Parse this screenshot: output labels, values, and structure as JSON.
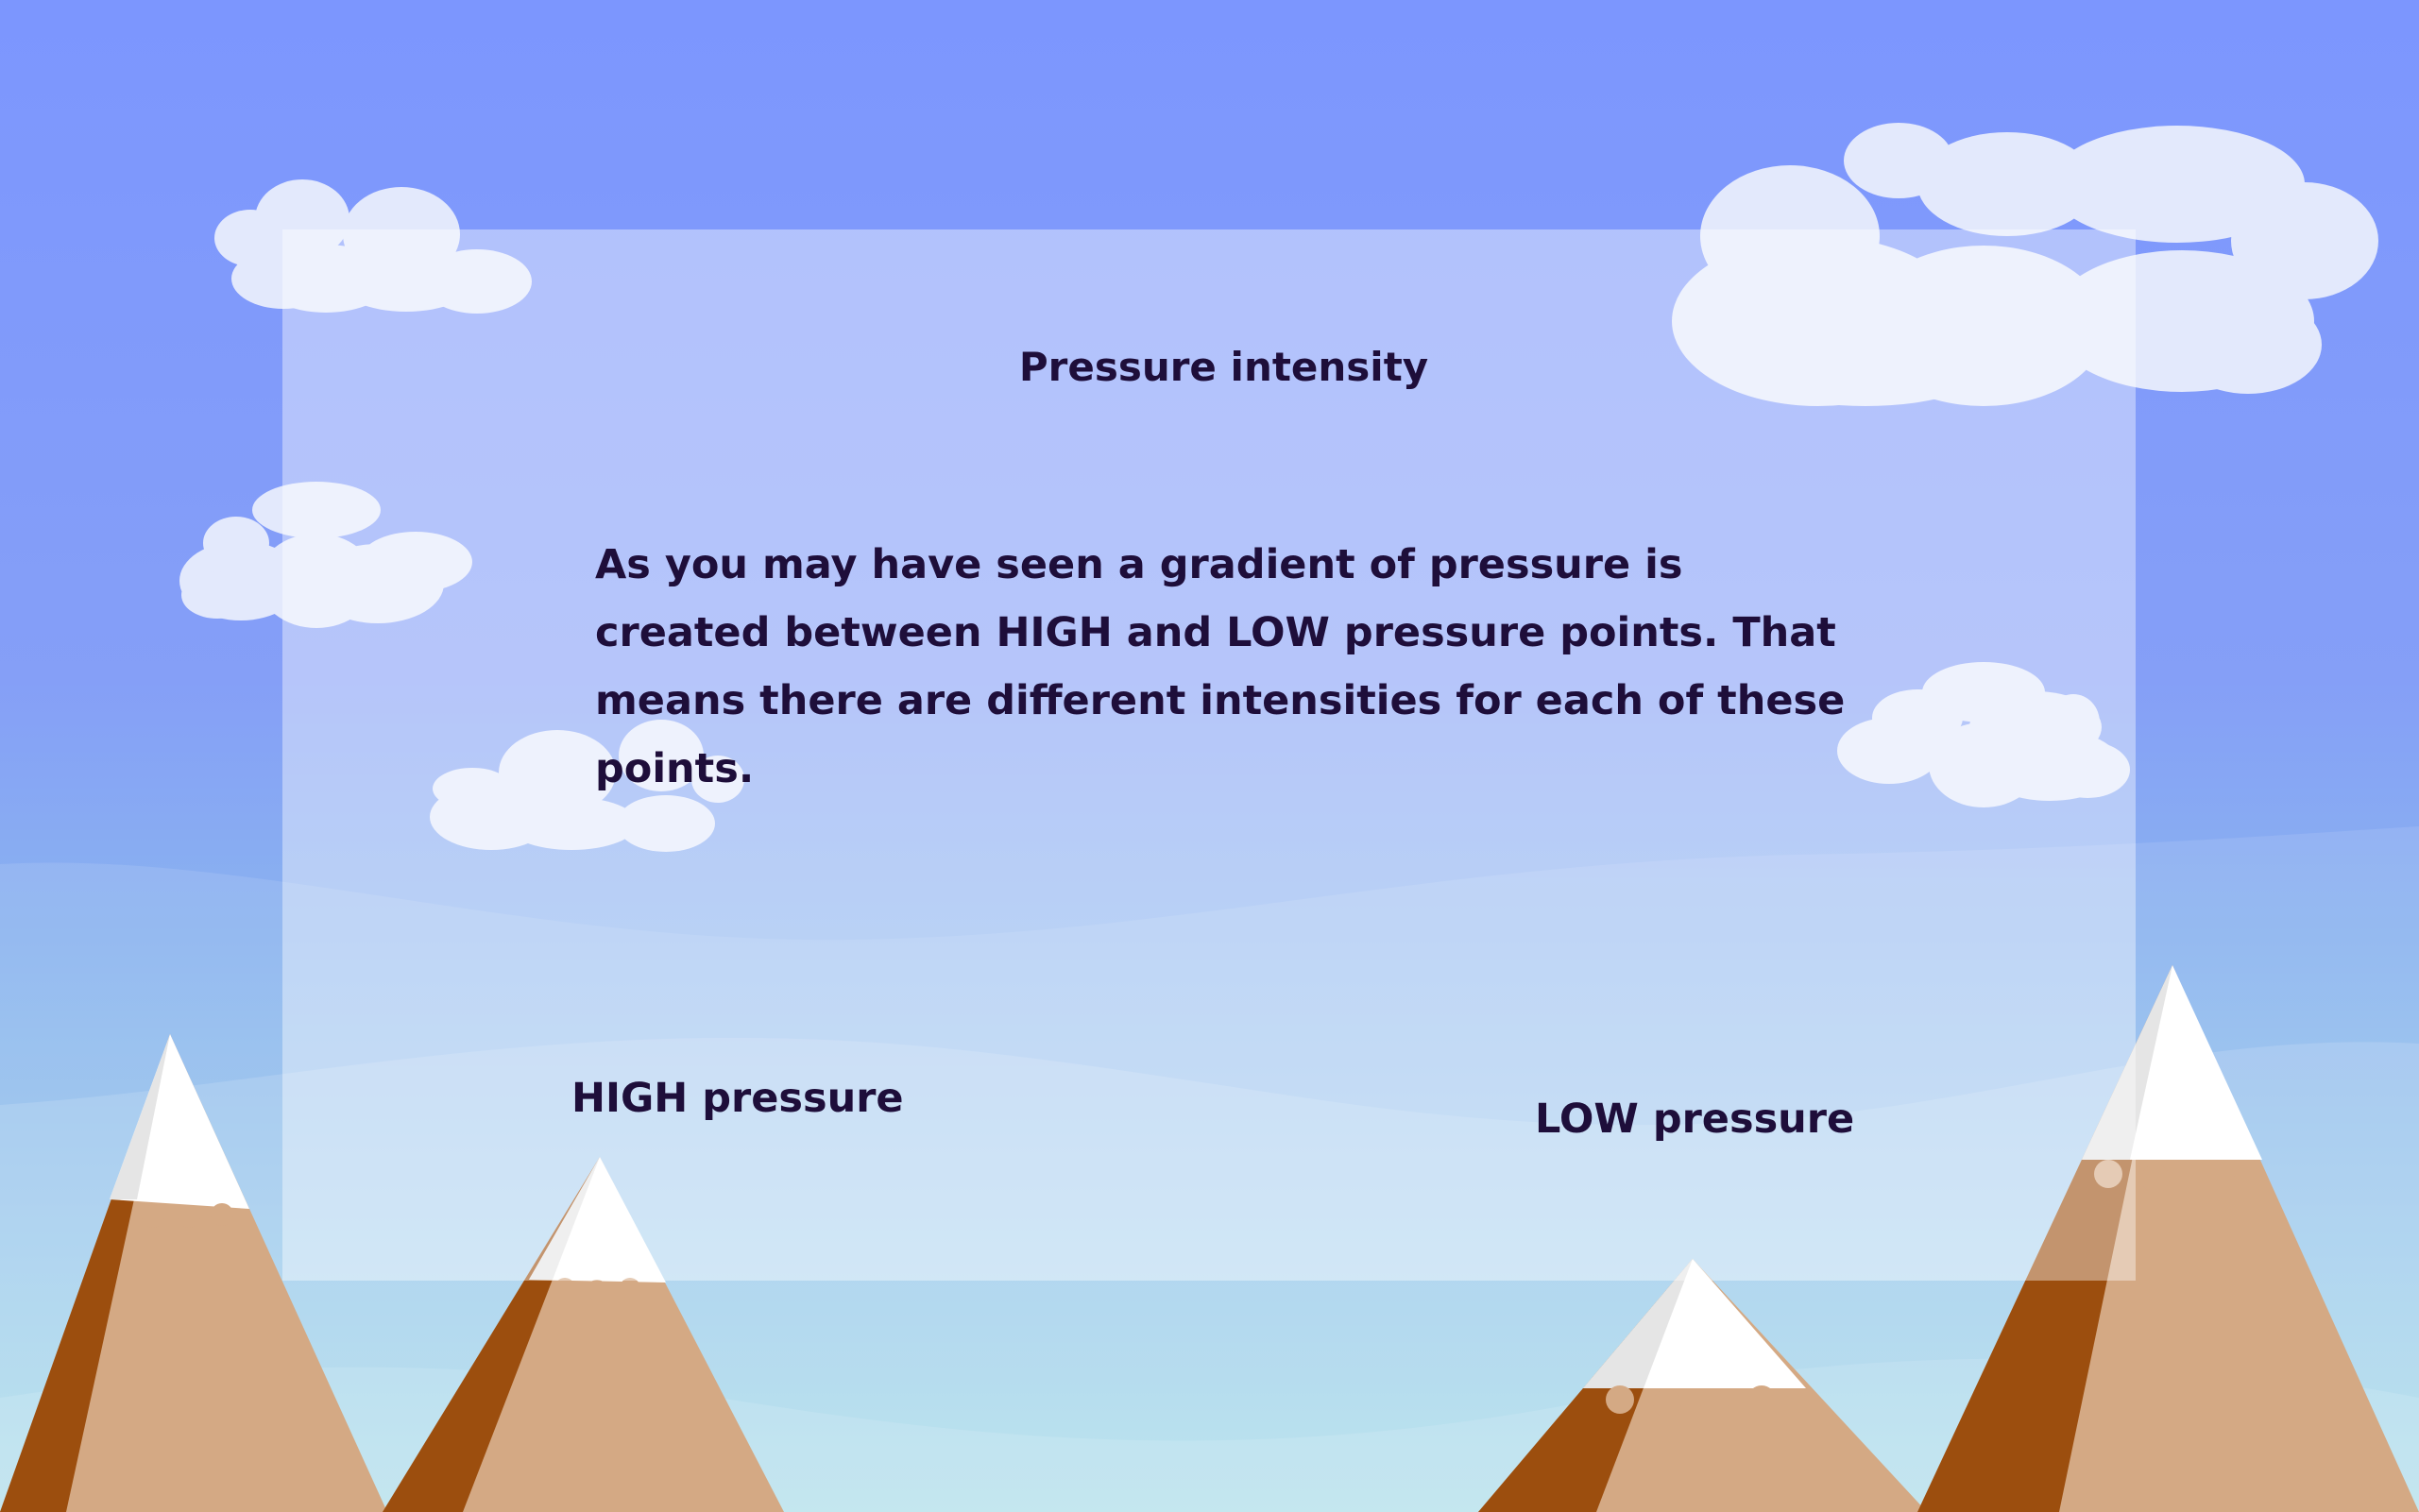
{
  "slide": {
    "title": "Pressure intensity",
    "body": "As you may have seen a gradient of pressure is created between HIGH and LOW pressure points. That means there are different intensities for each of these points.",
    "labels": {
      "high": "HIGH pressure",
      "low": "LOW pressure"
    }
  },
  "colors": {
    "sky_top": "#7b96fe",
    "sky_bottom": "#a8dce9",
    "panel": "#ffffff",
    "text": "#1e0e3a",
    "mountain_light": "#d4a984",
    "mountain_dark": "#9c4e0e",
    "snow": "#ffffff",
    "cloud": "#e3e9fc"
  }
}
